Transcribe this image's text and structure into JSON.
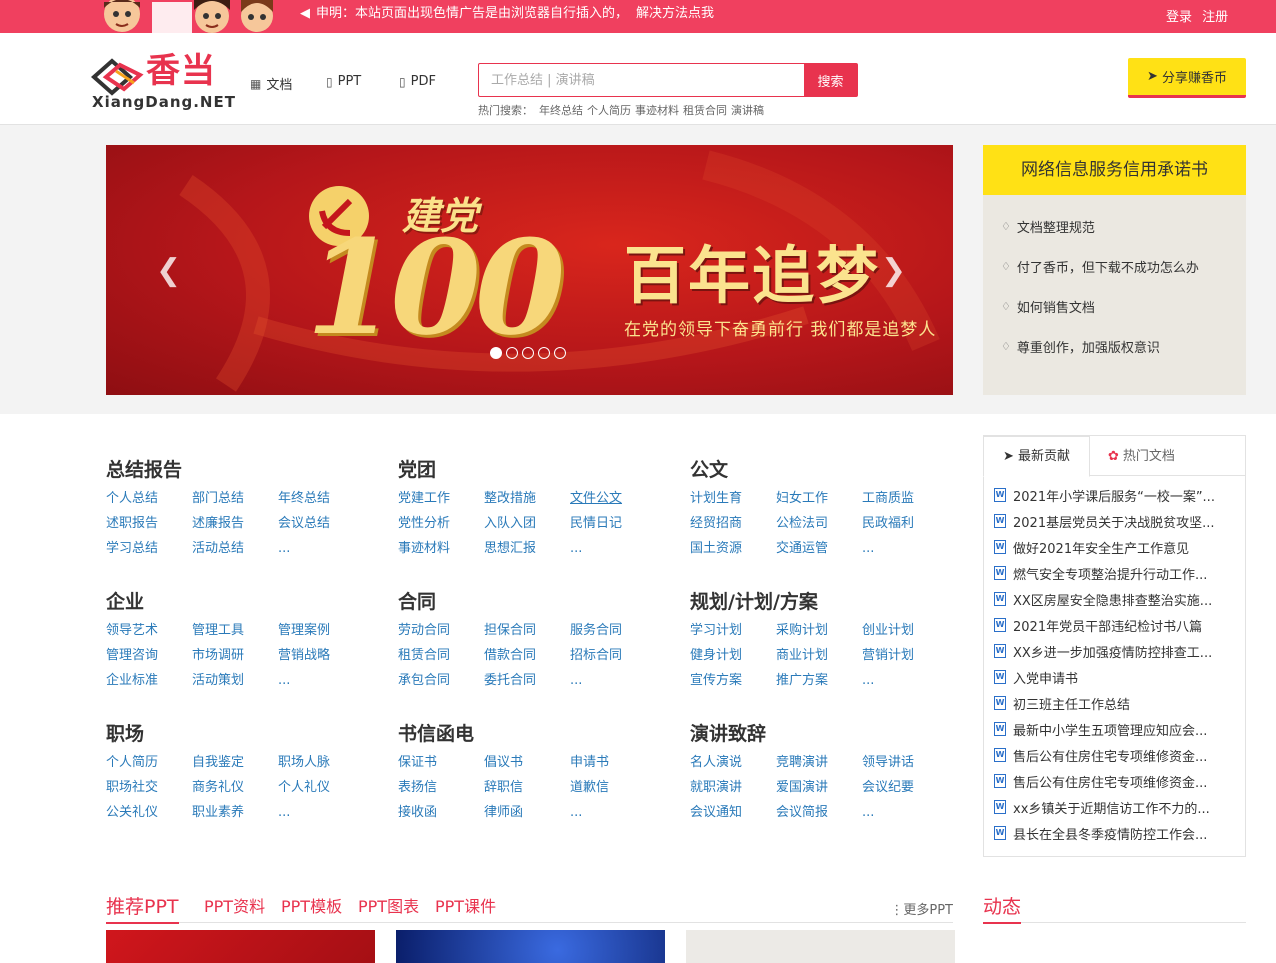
{
  "topbar": {
    "notice": "申明：本站页面出现色情广告是由浏览器自行插入的，",
    "notice_link": "解决方法点我",
    "login": "登录",
    "register": "注册"
  },
  "header": {
    "logo_cn": "香当",
    "logo_en": "XiangDang.NET",
    "nav": [
      {
        "label": "文档",
        "icon": "grid-icon"
      },
      {
        "label": "PPT",
        "icon": "ppt-file-icon"
      },
      {
        "label": "PDF",
        "icon": "pdf-file-icon"
      }
    ],
    "search_placeholder": "工作总结 | 演讲稿",
    "search_button": "搜索",
    "hot_label": "热门搜索：",
    "hot_terms": [
      "年终总结",
      "个人简历",
      "事迹材料",
      "租赁合同",
      "演讲稿"
    ],
    "share_button": "分享赚香币"
  },
  "banner": {
    "jiandang": "建党",
    "number": "100",
    "headline": "百年追梦",
    "subline": "在党的领导下奋勇前行 我们都是追梦人",
    "slides": 5,
    "active_slide": 1
  },
  "notice_panel": {
    "title": "网络信息服务信用承诺书",
    "items": [
      "文档整理规范",
      "付了香币，但下载不成功怎么办",
      "如何销售文档",
      "尊重创作，加强版权意识"
    ]
  },
  "categories": [
    {
      "title": "总结报告",
      "links": [
        "个人总结",
        "部门总结",
        "年终总结",
        "述职报告",
        "述廉报告",
        "会议总结",
        "学习总结",
        "活动总结",
        "..."
      ]
    },
    {
      "title": "党团",
      "links": [
        "党建工作",
        "整改措施",
        "文件公文",
        "党性分析",
        "入队入团",
        "民情日记",
        "事迹材料",
        "思想汇报",
        "..."
      ]
    },
    {
      "title": "公文",
      "links": [
        "计划生育",
        "妇女工作",
        "工商质监",
        "经贸招商",
        "公检法司",
        "民政福利",
        "国土资源",
        "交通运管",
        "..."
      ]
    },
    {
      "title": "企业",
      "links": [
        "领导艺术",
        "管理工具",
        "管理案例",
        "管理咨询",
        "市场调研",
        "营销战略",
        "企业标准",
        "活动策划",
        "..."
      ]
    },
    {
      "title": "合同",
      "links": [
        "劳动合同",
        "担保合同",
        "服务合同",
        "租赁合同",
        "借款合同",
        "招标合同",
        "承包合同",
        "委托合同",
        "..."
      ]
    },
    {
      "title": "规划/计划/方案",
      "links": [
        "学习计划",
        "采购计划",
        "创业计划",
        "健身计划",
        "商业计划",
        "营销计划",
        "宣传方案",
        "推广方案",
        "..."
      ]
    },
    {
      "title": "职场",
      "links": [
        "个人简历",
        "自我鉴定",
        "职场人脉",
        "职场社交",
        "商务礼仪",
        "个人礼仪",
        "公关礼仪",
        "职业素养",
        "..."
      ]
    },
    {
      "title": "书信函电",
      "links": [
        "保证书",
        "倡议书",
        "申请书",
        "表扬信",
        "辞职信",
        "道歉信",
        "接收函",
        "律师函",
        "..."
      ]
    },
    {
      "title": "演讲致辞",
      "links": [
        "名人演说",
        "竞聘演讲",
        "领导讲话",
        "就职演讲",
        "爱国演讲",
        "会议纪要",
        "会议通知",
        "会议简报",
        "..."
      ]
    }
  ],
  "tabs_panel": {
    "tab_latest": "最新贡献",
    "tab_hot": "热门文档",
    "docs": [
      "2021年小学课后服务“一校一案”...",
      "2021基层党员关于决战脱贫攻坚...",
      "做好2021年安全生产工作意见",
      "燃气安全专项整治提升行动工作...",
      "XX区房屋安全隐患排查整治实施...",
      "2021年党员干部违纪检讨书八篇",
      "XX乡进一步加强疫情防控排查工...",
      "入党申请书",
      "初三班主任工作总结",
      "最新中小学生五项管理应知应会...",
      "售后公有住房住宅专项维修资金...",
      "售后公有住房住宅专项维修资金...",
      "xx乡镇关于近期信访工作不力的...",
      "县长在全县冬季疫情防控工作会..."
    ]
  },
  "ppt_section": {
    "main": "推荐PPT",
    "tabs": [
      "PPT资料",
      "PPT模板",
      "PPT图表",
      "PPT课件"
    ],
    "more": "更多PPT"
  },
  "dongtai": {
    "title": "动态"
  },
  "colors": {
    "brand_red": "#e8334e",
    "yellow": "#ffe115",
    "link_blue": "#2a7ab9"
  }
}
